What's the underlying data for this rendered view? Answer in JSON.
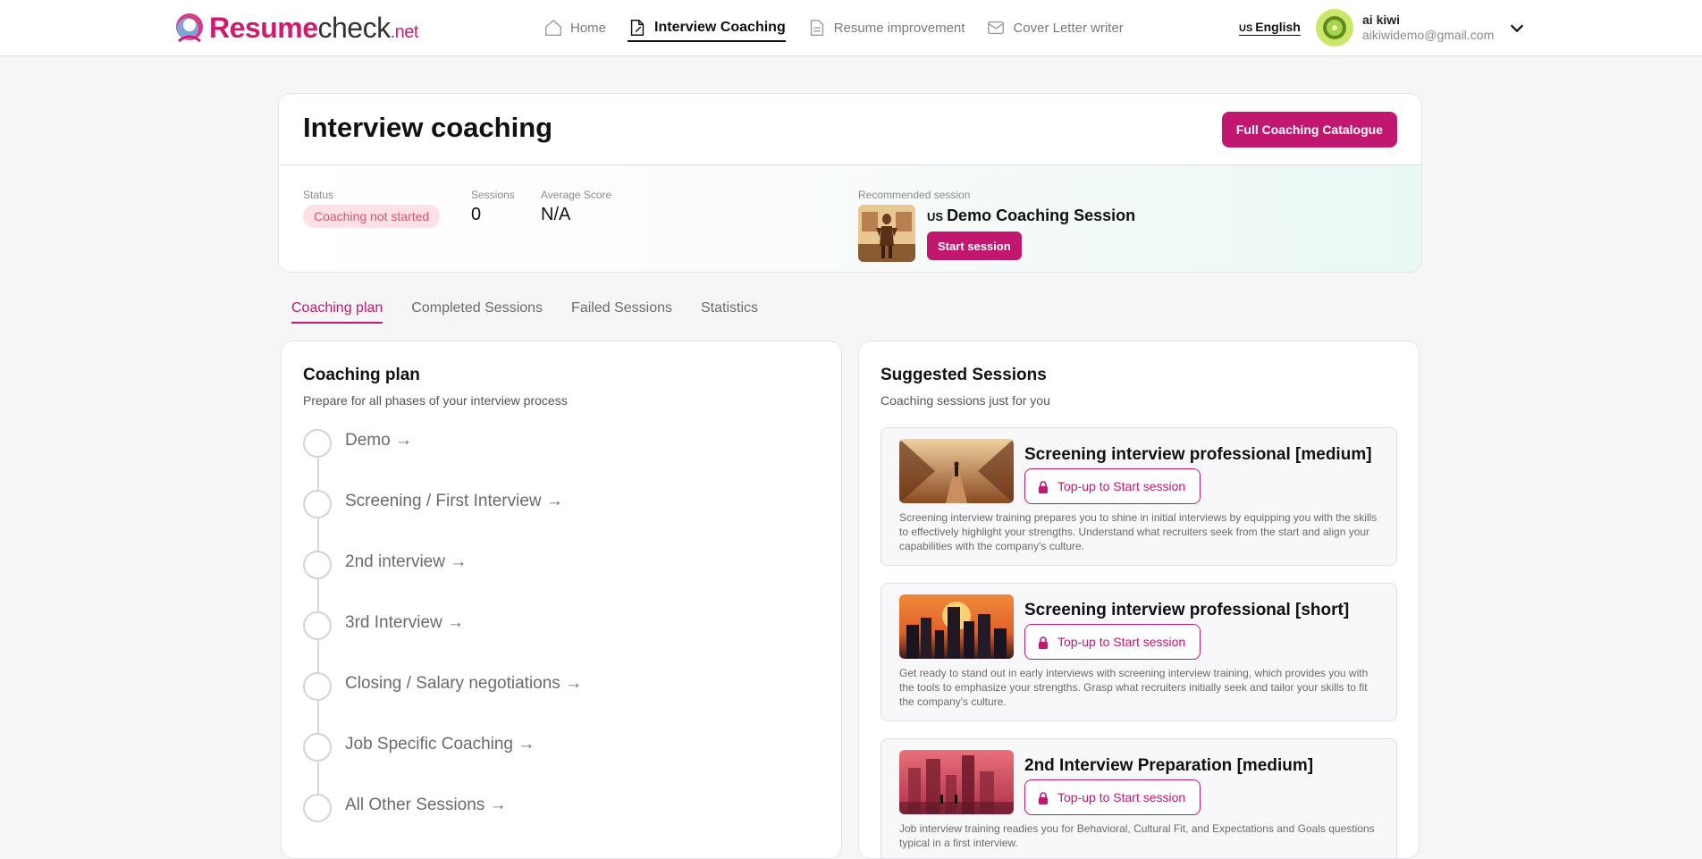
{
  "brand": {
    "part1": "Resume",
    "part2": "check",
    "part3": ".net"
  },
  "nav": {
    "items": [
      {
        "label": "Home",
        "icon": "home-icon"
      },
      {
        "label": "Interview Coaching",
        "icon": "document-edit-icon"
      },
      {
        "label": "Resume improvement",
        "icon": "document-icon"
      },
      {
        "label": "Cover Letter writer",
        "icon": "envelope-icon"
      }
    ]
  },
  "language": {
    "code": "US",
    "label": "English"
  },
  "user": {
    "name": "ai kiwi",
    "email": "aikiwidemo@gmail.com"
  },
  "hero": {
    "title": "Interview coaching",
    "catalogue_button": "Full Coaching Catalogue",
    "status_label": "Status",
    "status_value": "Coaching not started",
    "sessions_label": "Sessions",
    "sessions_value": "0",
    "score_label": "Average Score",
    "score_value": "N/A",
    "recommended_label": "Recommended session",
    "recommended_code": "US",
    "recommended_title": "Demo Coaching Session",
    "start_button": "Start session"
  },
  "tabs": [
    "Coaching plan",
    "Completed Sessions",
    "Failed Sessions",
    "Statistics"
  ],
  "plan": {
    "title": "Coaching plan",
    "subtitle": "Prepare for all phases of your interview process",
    "steps": [
      "Demo →",
      "Screening / First Interview →",
      "2nd interview →",
      "3rd Interview →",
      "Closing / Salary negotiations →",
      "Job Specific Coaching →",
      "All Other Sessions →"
    ]
  },
  "suggested": {
    "title": "Suggested Sessions",
    "subtitle": "Coaching sessions just for you",
    "sessions": [
      {
        "title": "Screening interview professional [medium]",
        "button": "Top-up to Start session",
        "description": "Screening interview training prepares you to shine in initial interviews by equipping you with the skills to effectively highlight your strengths. Understand what recruiters seek from the start and align your capabilities with the company's culture."
      },
      {
        "title": "Screening interview professional [short]",
        "button": "Top-up to Start session",
        "description": "Get ready to stand out in early interviews with screening interview training, which provides you with the tools to emphasize your strengths. Grasp what recruiters initially seek and tailor your skills to fit the company's culture."
      },
      {
        "title": "2nd Interview Preparation [medium]",
        "button": "Top-up to Start session",
        "description": "Job interview training readies you for Behavioral, Cultural Fit, and Expectations and Goals questions typical in a first interview."
      }
    ]
  },
  "colors": {
    "accent": "#c2176f",
    "badge_bg": "#fde1e7",
    "badge_text": "#d2566f"
  }
}
